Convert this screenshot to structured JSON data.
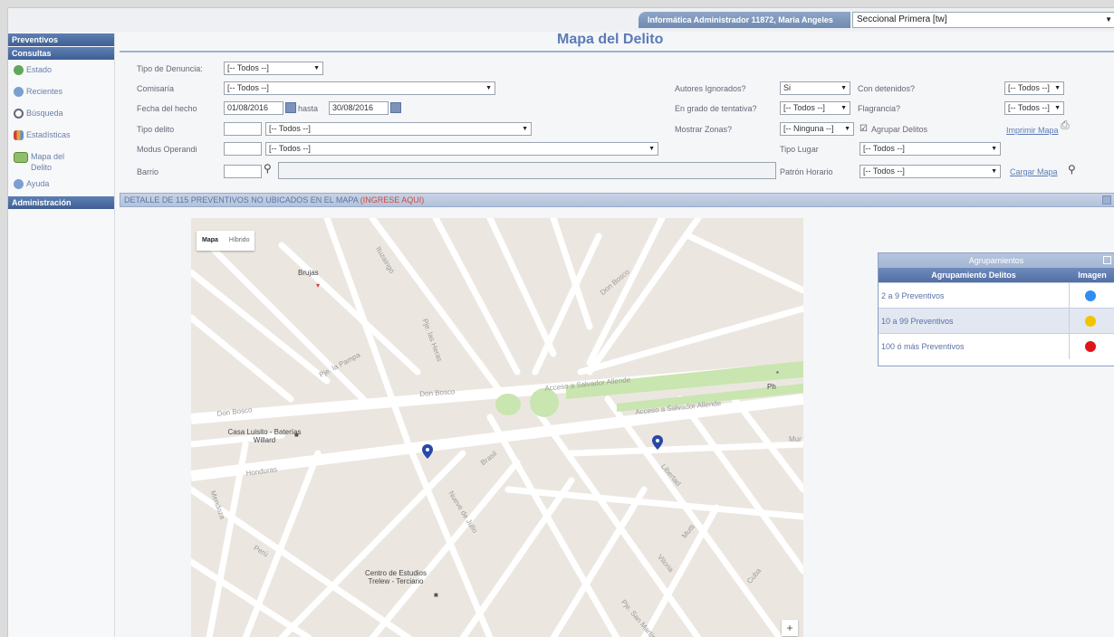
{
  "header": {
    "user": "Informática Administrador 11872, Maria Angeles",
    "seccional": "Seccional Primera [tw]"
  },
  "sidebar": {
    "sections": {
      "preventivos": "Preventivos",
      "consultas": "Consultas",
      "administracion": "Administración"
    },
    "items": [
      {
        "label": "Estado",
        "icon": "refresh-icon"
      },
      {
        "label": "Recientes",
        "icon": "recent-icon"
      },
      {
        "label": "Búsqueda",
        "icon": "search-icon"
      },
      {
        "label": "Estadísticas",
        "icon": "stats-icon"
      },
      {
        "label": "Mapa del Delito",
        "icon": "map-icon"
      },
      {
        "label": "Ayuda",
        "icon": "help-icon"
      }
    ]
  },
  "page": {
    "title": "Mapa del Delito"
  },
  "filters": {
    "tipo_denuncia": {
      "label": "Tipo de Denuncia:",
      "value": "[-- Todos --]"
    },
    "comisaria": {
      "label": "Comisaría",
      "value": "[-- Todos --]"
    },
    "fecha": {
      "label": "Fecha del hecho",
      "desde": "01/08/2016",
      "hasta_label": "hasta",
      "hasta": "30/08/2016"
    },
    "tipo_delito": {
      "label": "Tipo delito",
      "code": "",
      "value": "[-- Todos --]"
    },
    "modus": {
      "label": "Modus Operandi",
      "code": "",
      "value": "[-- Todos --]"
    },
    "barrio": {
      "label": "Barrio",
      "code": "",
      "value": ""
    },
    "autores": {
      "label": "Autores Ignorados?",
      "value": "Si"
    },
    "con_detenidos": {
      "label": "Con detenidos?",
      "value": "[-- Todos --]"
    },
    "grado_tentativa": {
      "label": "En grado de tentativa?",
      "value": "[-- Todos --]"
    },
    "flagrancia": {
      "label": "Flagrancia?",
      "value": "[-- Todos --]"
    },
    "mostrar_zonas": {
      "label": "Mostrar Zonas?",
      "value": "[-- Ninguna --]"
    },
    "agrupar": {
      "label": "Agrupar Delitos",
      "checked": true
    },
    "imprimir": "Imprimir Mapa",
    "tipo_lugar": {
      "label": "Tipo Lugar",
      "value": "[-- Todos --]"
    },
    "patron_horario": {
      "label": "Patrón Horario",
      "value": "[-- Todos --]"
    },
    "cargar": "Cargar Mapa"
  },
  "detail_bar": {
    "text": "DETALLE DE 115 PREVENTIVOS NO UBICADOS EN EL MAPA",
    "link": "(INGRESE AQUI)"
  },
  "map": {
    "tabs": [
      "Mapa",
      "Híbrido"
    ],
    "places": {
      "brujas": "Brujas",
      "casa": "Casa Luisito - Baterías Willard",
      "centro": "Centro de Estudios Trelew - Terciario",
      "ph": "Ph"
    },
    "streets": {
      "don_bosco_w": "Don Bosco",
      "don_bosco_c": "Don Bosco",
      "don_bosco_n": "Don Bosco",
      "acceso1": "Acceso a Salvador Allende",
      "acceso2": "Acceso a Salvador Allende",
      "honduras": "Honduras",
      "brasil": "Brasil",
      "la_pampa": "Pje. la Pampa",
      "ituzaingo": "Ituzaingó",
      "las_heras": "Pje. las Heras",
      "nueve_julio": "Nueve de Julio",
      "mendoza": "Mendoza",
      "peru": "Perú",
      "mutti": "Mutti",
      "mur": "Mur",
      "vitoria": "Vitoria",
      "cuba": "Cuba",
      "pje_san": "Pje. San Martín",
      "libertad": "Libertad"
    },
    "zoom_in": "+"
  },
  "legend": {
    "title": "Agrupamientos",
    "columns": [
      "Agrupamiento Delitos",
      "Imagen"
    ],
    "rows": [
      {
        "label": "2 a 9 Preventivos",
        "color": "#2f8ef0"
      },
      {
        "label": "10 a 99 Preventivos",
        "color": "#f2c400"
      },
      {
        "label": "100 ó más Preventivos",
        "color": "#e0141b"
      }
    ]
  },
  "colors": {
    "accent": "#5a7bb8",
    "header": "#4a6aa1",
    "map_park": "#c9e5b0",
    "marker": "#2847a8"
  }
}
